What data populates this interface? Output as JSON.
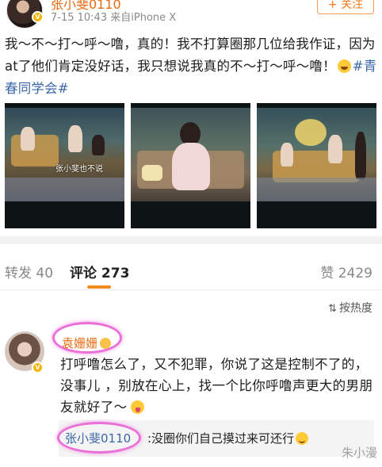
{
  "post": {
    "author": "张小斐0110",
    "time": "7-15 10:43",
    "source": "来自iPhone X",
    "follow_label": "+ 关注",
    "text_main": "我～不～打～呼～噜，真的！我不打算圈那几位给我作证，因为at了他们肯定没好话，我只想说我真的不～打～呼～噜！",
    "hashtag": "#青春同学会#",
    "images": [
      {
        "caption": "",
        "overlay": "张小斐也不说"
      },
      {
        "caption": "",
        "overlay": ""
      },
      {
        "caption": "",
        "overlay": ""
      }
    ]
  },
  "tabs": {
    "repost": "转发 40",
    "comment": "评论 273",
    "like": "赞 2429"
  },
  "sort": {
    "label": "按热度"
  },
  "comment": {
    "name": "袁姗姗",
    "body": "打呼噜怎么了，又不犯罪，你说了这是控制不了的，没事儿 ，别放在心上，找一个比你呼噜声更大的男朋友就好了～",
    "reply_author": "张小斐0110",
    "reply_text": ":没圈你们自己摸过来可还行"
  },
  "watermark": "朱小漫",
  "colors": {
    "accent_orange": "#e86b12",
    "link_blue": "#3a67a8",
    "highlight_pink": "#ea6fd6"
  }
}
